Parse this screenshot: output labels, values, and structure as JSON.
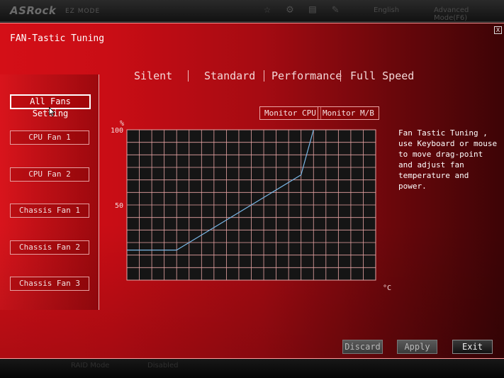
{
  "topbar": {
    "brand": "ASRock",
    "mode": "EZ MODE",
    "right_text_1": "English",
    "right_text_2": "Advanced Mode(F6)"
  },
  "bottombar": {
    "text_1": "RAID Mode",
    "text_2": "Disabled"
  },
  "dialog": {
    "title": "FAN-Tastic Tuning",
    "close_label": "X"
  },
  "fans": [
    {
      "label": "All Fans Setting",
      "active": true
    },
    {
      "label": "CPU Fan 1",
      "active": false
    },
    {
      "label": "CPU Fan 2",
      "active": false
    },
    {
      "label": "Chassis Fan 1",
      "active": false
    },
    {
      "label": "Chassis Fan 2",
      "active": false
    },
    {
      "label": "Chassis Fan 3",
      "active": false
    }
  ],
  "presets": [
    "Silent",
    "Standard",
    "Performance",
    "Full Speed"
  ],
  "monitor": {
    "cpu_label": "Monitor CPU",
    "mb_label": "Monitor M/B"
  },
  "help_text": "Fan Tastic Tuning , use Keyboard or mouse to move drag-point and adjust fan temperature and power.",
  "footer": {
    "discard_label": "Discard",
    "apply_label": "Apply",
    "exit_label": "Exit"
  },
  "colors": {
    "curve": "#7ab7e6",
    "grid": "#e7a3a3",
    "plot_bg": "#151515"
  },
  "chart_data": {
    "type": "line",
    "xlabel": "°C",
    "ylabel": "%",
    "xlim": [
      0,
      100
    ],
    "ylim": [
      0,
      100
    ],
    "x_ticks": [
      "0",
      "25",
      "50",
      "75",
      "100"
    ],
    "y_ticks": [
      "50",
      "100"
    ],
    "grid": true,
    "series": [
      {
        "x": [
          0,
          20,
          70,
          75
        ],
        "values": [
          20,
          20,
          70,
          100
        ]
      }
    ]
  }
}
